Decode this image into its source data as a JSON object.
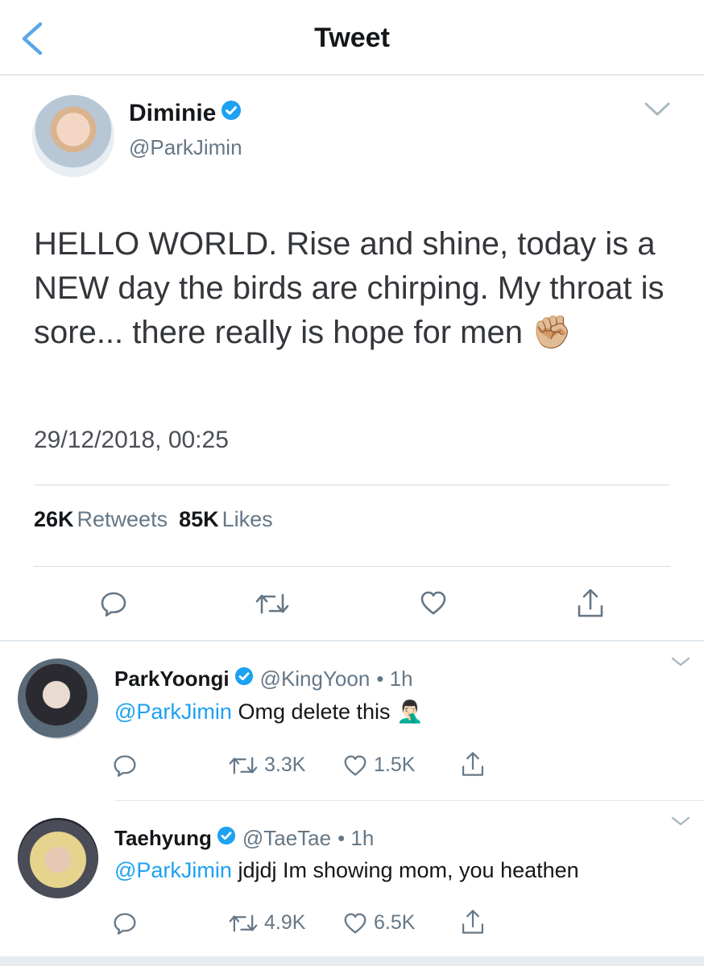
{
  "nav": {
    "title": "Tweet"
  },
  "tweet": {
    "author_name": "Diminie",
    "author_handle": "@ParkJimin",
    "text": "HELLO WORLD. Rise and shine, today is a NEW day the birds are chirping. My throat is sore... there really is hope for men",
    "emoji": "✊🏼",
    "timestamp": "29/12/2018, 00:25",
    "retweets_count": "26K",
    "retweets_label": "Retweets",
    "likes_count": "85K",
    "likes_label": "Likes"
  },
  "replies": [
    {
      "name": "ParkYoongi",
      "handle": "@KingYoon",
      "time": "• 1h",
      "mention": "@ParkJimin",
      "text": "Omg delete this",
      "emoji": "🤦🏻‍♂️",
      "retweets": "3.3K",
      "likes": "1.5K"
    },
    {
      "name": "Taehyung",
      "handle": "@TaeTae",
      "time": "• 1h",
      "mention": "@ParkJimin",
      "text": "jdjdj Im showing mom, you heathen",
      "emoji": "",
      "retweets": "4.9K",
      "likes": "6.5K"
    }
  ],
  "colors": {
    "accent": "#1da1f2",
    "secondary_text": "#657786",
    "divider": "#e1e8ed",
    "back_arrow": "#5aa6e6"
  },
  "icons": [
    "back-chevron-icon",
    "verified-badge-icon",
    "chevron-down-icon",
    "reply-icon",
    "retweet-icon",
    "like-icon",
    "share-icon"
  ]
}
